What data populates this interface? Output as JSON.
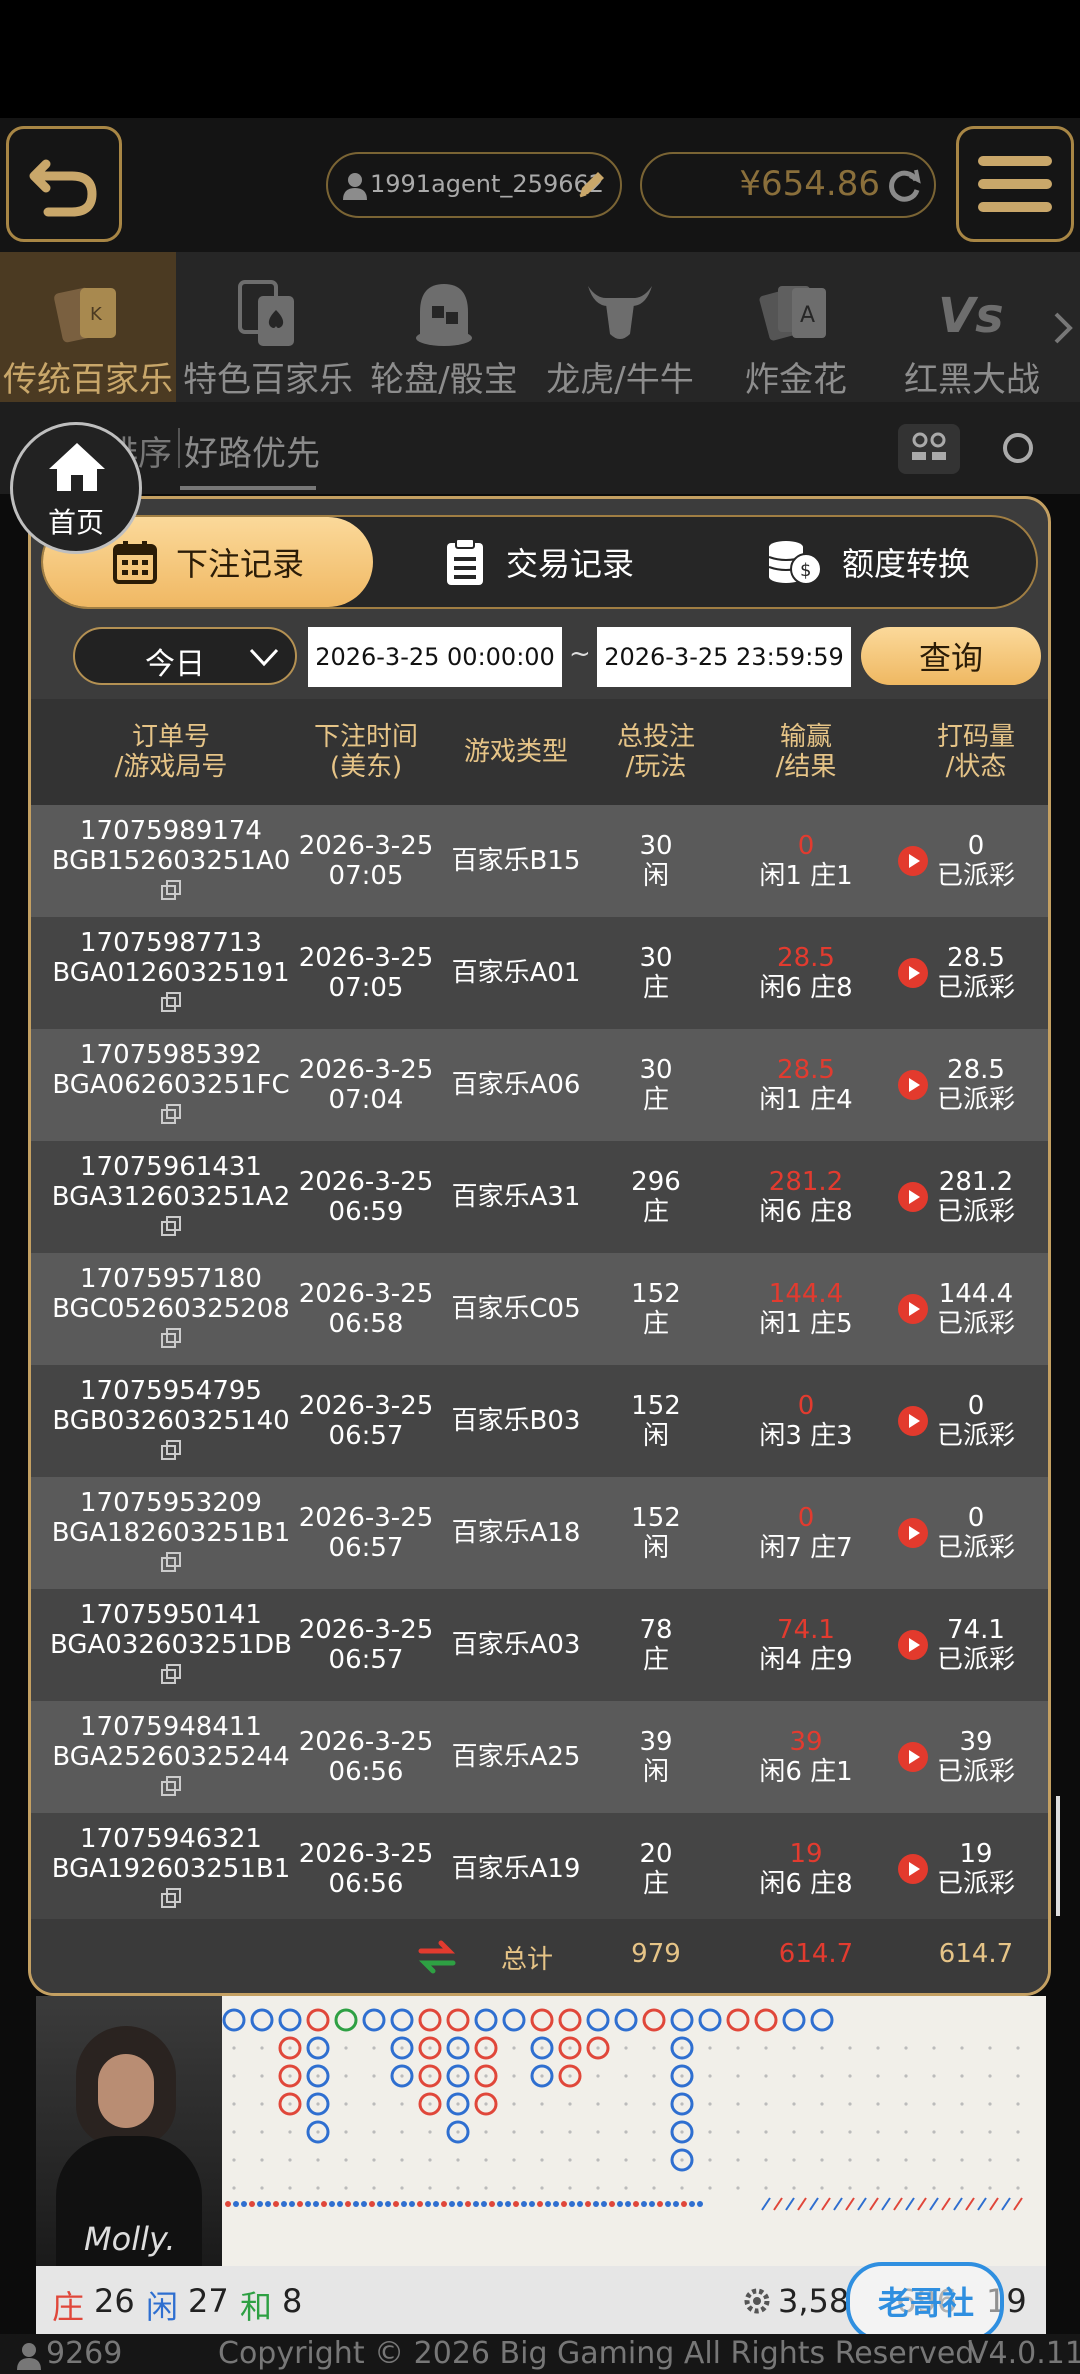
{
  "header": {
    "username": "1991agent_259662",
    "balance": "¥654.86",
    "icons": [
      "back-arrow-icon",
      "user-icon",
      "edit-pencil-icon",
      "refresh-icon",
      "menu-icon"
    ]
  },
  "categories": [
    {
      "label": "传统百家乐",
      "icon": "cards-icon",
      "active": true
    },
    {
      "label": "特色百家乐",
      "icon": "spade-card-icon",
      "active": false
    },
    {
      "label": "轮盘/骰宝",
      "icon": "dice-icon",
      "active": false
    },
    {
      "label": "龙虎/牛牛",
      "icon": "bull-icon",
      "active": false
    },
    {
      "label": "炸金花",
      "icon": "ace-cards-icon",
      "active": false
    },
    {
      "label": "红黑大战",
      "icon": "vs-icon",
      "active": false
    }
  ],
  "sort": {
    "left_partial": "注排序",
    "right": "好路优先"
  },
  "home_button": {
    "label": "首页"
  },
  "modal": {
    "tabs": [
      {
        "label": "下注记录",
        "icon": "calendar-icon"
      },
      {
        "label": "交易记录",
        "icon": "clipboard-icon"
      },
      {
        "label": "额度转换",
        "icon": "coin-stack-icon"
      }
    ],
    "filter": {
      "period": "今日",
      "start": "2026-3-25 00:00:00",
      "separator": "~",
      "end": "2026-3-25 23:59:59",
      "query_label": "查询"
    },
    "columns": {
      "order": [
        "订单号",
        "/游戏局号"
      ],
      "time": [
        "下注时间",
        "(美东)"
      ],
      "game": "游戏类型",
      "bet": [
        "总投注",
        "/玩法"
      ],
      "win": [
        "输赢",
        "/结果"
      ],
      "code": [
        "打码量",
        "/状态"
      ]
    },
    "rows": [
      {
        "order": "17075989174",
        "round": "BGB152603251A0",
        "date": "2026-3-25",
        "time": "07:05",
        "game": "百家乐B15",
        "bet": "30",
        "side": "闲",
        "win": "0",
        "result": "闲1 庄1",
        "code": "0",
        "status": "已派彩"
      },
      {
        "order": "17075987713",
        "round": "BGA01260325191",
        "date": "2026-3-25",
        "time": "07:05",
        "game": "百家乐A01",
        "bet": "30",
        "side": "庄",
        "win": "28.5",
        "result": "闲6 庄8",
        "code": "28.5",
        "status": "已派彩"
      },
      {
        "order": "17075985392",
        "round": "BGA062603251FC",
        "date": "2026-3-25",
        "time": "07:04",
        "game": "百家乐A06",
        "bet": "30",
        "side": "庄",
        "win": "28.5",
        "result": "闲1 庄4",
        "code": "28.5",
        "status": "已派彩"
      },
      {
        "order": "17075961431",
        "round": "BGA312603251A2",
        "date": "2026-3-25",
        "time": "06:59",
        "game": "百家乐A31",
        "bet": "296",
        "side": "庄",
        "win": "281.2",
        "result": "闲6 庄8",
        "code": "281.2",
        "status": "已派彩"
      },
      {
        "order": "17075957180",
        "round": "BGC05260325208",
        "date": "2026-3-25",
        "time": "06:58",
        "game": "百家乐C05",
        "bet": "152",
        "side": "庄",
        "win": "144.4",
        "result": "闲1 庄5",
        "code": "144.4",
        "status": "已派彩"
      },
      {
        "order": "17075954795",
        "round": "BGB03260325140",
        "date": "2026-3-25",
        "time": "06:57",
        "game": "百家乐B03",
        "bet": "152",
        "side": "闲",
        "win": "0",
        "result": "闲3 庄3",
        "code": "0",
        "status": "已派彩"
      },
      {
        "order": "17075953209",
        "round": "BGA182603251B1",
        "date": "2026-3-25",
        "time": "06:57",
        "game": "百家乐A18",
        "bet": "152",
        "side": "闲",
        "win": "0",
        "result": "闲7 庄7",
        "code": "0",
        "status": "已派彩"
      },
      {
        "order": "17075950141",
        "round": "BGA032603251DB",
        "date": "2026-3-25",
        "time": "06:57",
        "game": "百家乐A03",
        "bet": "78",
        "side": "庄",
        "win": "74.1",
        "result": "闲4 庄9",
        "code": "74.1",
        "status": "已派彩"
      },
      {
        "order": "17075948411",
        "round": "BGA25260325244",
        "date": "2026-3-25",
        "time": "06:56",
        "game": "百家乐A25",
        "bet": "39",
        "side": "闲",
        "win": "39",
        "result": "闲6 庄1",
        "code": "39",
        "status": "已派彩"
      },
      {
        "order": "17075946321",
        "round": "BGA192603251B1",
        "date": "2026-3-25",
        "time": "06:56",
        "game": "百家乐A19",
        "bet": "20",
        "side": "庄",
        "win": "19",
        "result": "闲6 庄8",
        "code": "19",
        "status": "已派彩"
      }
    ],
    "total": {
      "label": "总计",
      "bet": "979",
      "win": "614.7",
      "code": "614.7"
    }
  },
  "game": {
    "dealer": "Molly.",
    "stats": {
      "banker_label": "庄",
      "banker": "26",
      "player_label": "闲",
      "player": "27",
      "tie_label": "和",
      "tie": "8",
      "pool": "3,58",
      "pool_suffix": "696",
      "players": "19"
    },
    "colors": {
      "banker": "#e0473a",
      "player": "#2f6fd0",
      "tie": "#2ea043"
    }
  },
  "footer": {
    "online": "9269",
    "copyright": "Copyright © 2026 Big Gaming All Rights Reserved",
    "version": "V4.0.11"
  },
  "watermark": "老哥社区"
}
